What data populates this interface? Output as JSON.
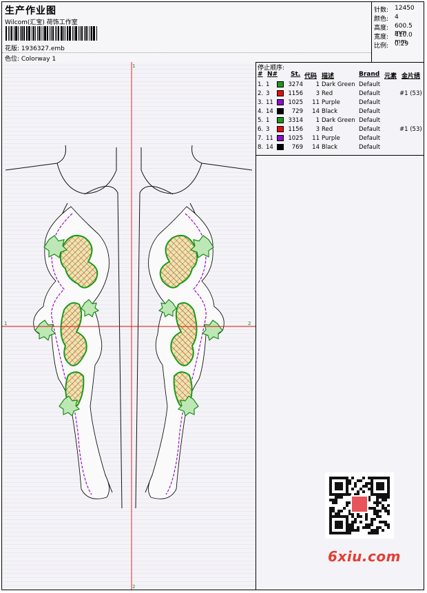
{
  "header": {
    "title": "生产作业图",
    "company": "Wilcom(汇宝) 荷饰工作室",
    "design_label": "花版: 1936327.emb",
    "colorway_label": "色位: Colorway 1"
  },
  "stats": [
    {
      "label": "针数:",
      "value": "12450"
    },
    {
      "label": "颜色:",
      "value": "4"
    },
    {
      "label": "高度:",
      "value": "600.5 mm"
    },
    {
      "label": "宽度:",
      "value": "410.0 mm"
    },
    {
      "label": "比例:",
      "value": "0.29"
    }
  ],
  "stop_sequence": {
    "title": "停止顺序:",
    "columns": [
      "#",
      "N#",
      "St.",
      "代码",
      "描述",
      "Brand",
      "元素",
      "金片绣"
    ],
    "rows": [
      {
        "idx": "1.",
        "n": "1",
        "color": "#1a9a1a",
        "stitches": "3274",
        "code": "1",
        "desc": "Dark Green",
        "brand": "Default",
        "sequin": ""
      },
      {
        "idx": "2.",
        "n": "3",
        "color": "#e01010",
        "stitches": "1156",
        "code": "3",
        "desc": "Red",
        "brand": "Default",
        "sequin": "#1 (53)"
      },
      {
        "idx": "3.",
        "n": "11",
        "color": "#8a10c8",
        "stitches": "1025",
        "code": "11",
        "desc": "Purple",
        "brand": "Default",
        "sequin": ""
      },
      {
        "idx": "4.",
        "n": "14",
        "color": "#000000",
        "stitches": "729",
        "code": "14",
        "desc": "Black",
        "brand": "Default",
        "sequin": ""
      },
      {
        "idx": "5.",
        "n": "1",
        "color": "#1a9a1a",
        "stitches": "3314",
        "code": "1",
        "desc": "Dark Green",
        "brand": "Default",
        "sequin": ""
      },
      {
        "idx": "6.",
        "n": "3",
        "color": "#e01010",
        "stitches": "1156",
        "code": "3",
        "desc": "Red",
        "brand": "Default",
        "sequin": "#1 (53)"
      },
      {
        "idx": "7.",
        "n": "11",
        "color": "#8a10c8",
        "stitches": "1025",
        "code": "11",
        "desc": "Purple",
        "brand": "Default",
        "sequin": ""
      },
      {
        "idx": "8.",
        "n": "14",
        "color": "#000000",
        "stitches": "769",
        "code": "14",
        "desc": "Black",
        "brand": "Default",
        "sequin": ""
      }
    ]
  },
  "guide_labels": {
    "top": "1",
    "bottom": "2",
    "left": "1",
    "right": "2"
  },
  "watermark": "6xiu.com",
  "qr_seal": "汉绣\n图库"
}
